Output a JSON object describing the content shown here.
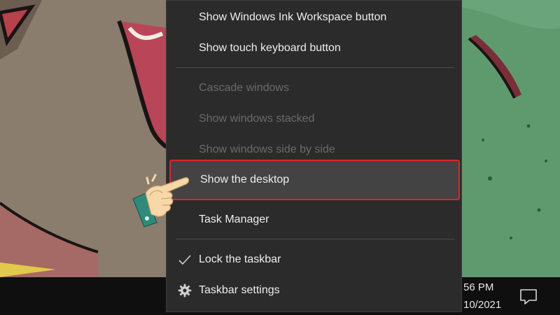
{
  "context_menu": {
    "items": [
      {
        "label": "Show Windows Ink Workspace button",
        "enabled": true
      },
      {
        "label": "Show touch keyboard button",
        "enabled": true
      },
      {
        "label": "Cascade windows",
        "enabled": false
      },
      {
        "label": "Show windows stacked",
        "enabled": false
      },
      {
        "label": "Show windows side by side",
        "enabled": false
      },
      {
        "label": "Show the desktop",
        "enabled": true,
        "highlighted": true
      },
      {
        "label": "Task Manager",
        "enabled": true
      },
      {
        "label": "Lock the taskbar",
        "enabled": true,
        "checked": true,
        "icon": "checkmark-icon"
      },
      {
        "label": "Taskbar settings",
        "enabled": true,
        "icon": "gear-icon"
      }
    ]
  },
  "taskbar": {
    "clock_time": "56 PM",
    "clock_date": "10/2021",
    "notification_icon": "action-center-icon"
  },
  "annotation": {
    "icon": "pointing-hand-icon",
    "highlight_color": "#e2222a"
  },
  "colors": {
    "menu_background": "#2b2b2b",
    "menu_text": "#ededed",
    "menu_text_disabled": "#6a6a6a",
    "highlight_background": "#434343",
    "taskbar_background": "#0f0f0f"
  }
}
